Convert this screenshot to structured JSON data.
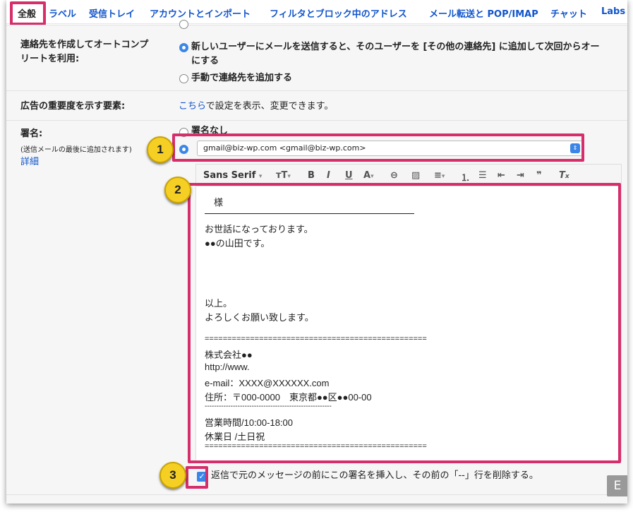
{
  "tabs": [
    "全般",
    "ラベル",
    "受信トレイ",
    "アカウントとインポート",
    "フィルタとブロック中のアドレス",
    "メール転送と POP/IMAP",
    "チャット",
    "Labs"
  ],
  "autocomplete": {
    "label_line1": "連絡先を作成してオートコンプ",
    "label_line2": "リートを利用:",
    "option1_line1": "新しいユーザーにメールを送信すると、そのユーザーを [その他の連絡先] に追加して次回からオー",
    "option1_line2": "にする",
    "option2": "手動で連絡先を追加する"
  },
  "ads": {
    "label": "広告の重要度を示す要素:",
    "link": "こちら",
    "text": "で設定を表示、変更できます。"
  },
  "signature": {
    "label": "署名:",
    "sub": "(送信メールの最後に追加されます)",
    "details_link": "詳細",
    "none_option": "署名なし",
    "account": "gmail@biz-wp.com <gmail@biz-wp.com>",
    "font": "Sans Serif",
    "lines": [
      "　様",
      "",
      "お世話になっております。",
      "●●の山田です。",
      "",
      "",
      "",
      "以上。",
      "よろしくお願い致します。",
      "",
      "=================================================",
      "株式会社●●",
      "http://www.",
      "e-mail：XXXX@XXXXXX.com",
      "住所：〒000-0000　東京都●●区●●00-00",
      "------------------------------------------------------",
      "営業時間/10:00-18:00",
      "休業日 /土日祝",
      "================================================="
    ]
  },
  "reply_option": "返信で元のメッセージの前にこの署名を挿入し、その前の「--」行を削除する。",
  "badges": [
    "1",
    "2",
    "3"
  ],
  "corner_label": "E",
  "colors": {
    "accent": "#d62e6b",
    "link": "#1155cc",
    "badge": "#f5cf23"
  }
}
